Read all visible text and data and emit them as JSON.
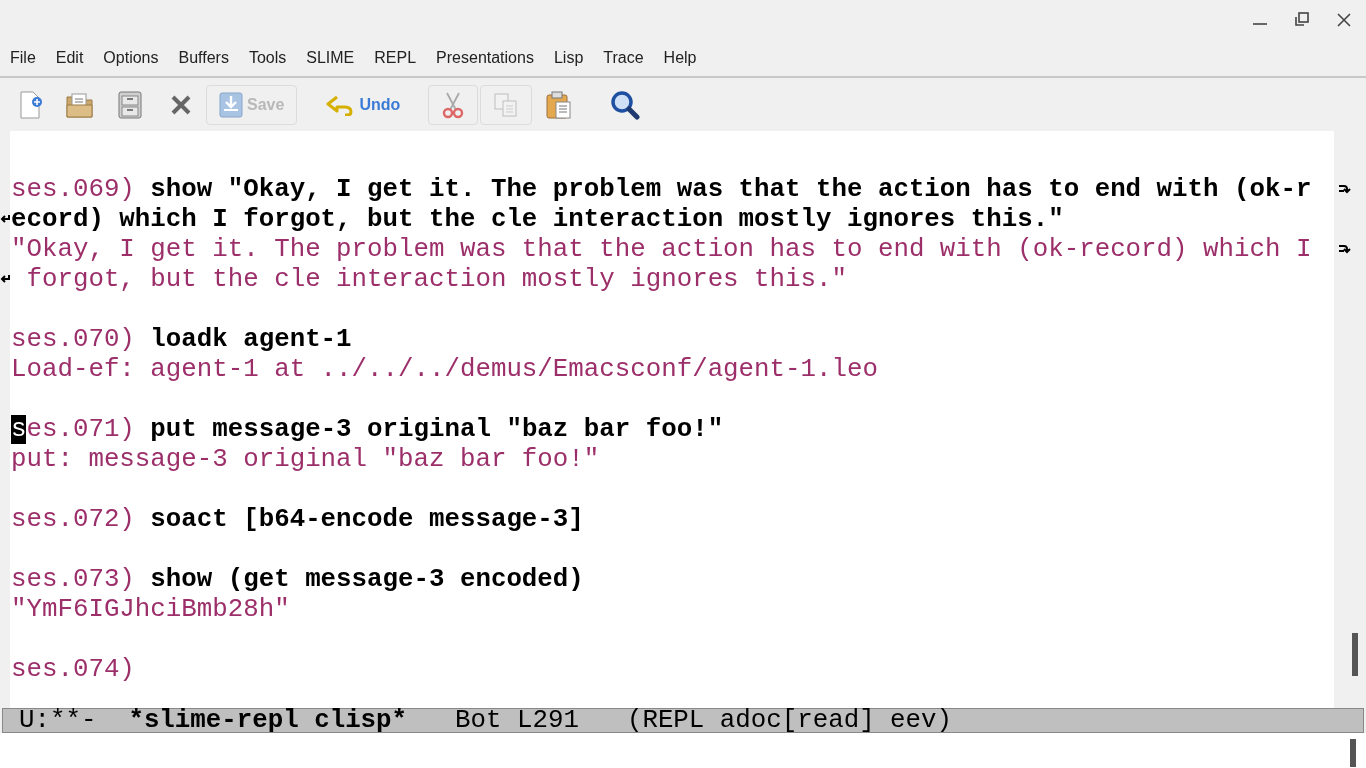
{
  "window": {
    "controls": [
      {
        "kind": "minimize"
      },
      {
        "kind": "restore"
      },
      {
        "kind": "close"
      }
    ]
  },
  "menu_bar": [
    "File",
    "Edit",
    "Options",
    "Buffers",
    "Tools",
    "SLIME",
    "REPL",
    "Presentations",
    "Lisp",
    "Trace",
    "Help"
  ],
  "toolbar": [
    {
      "kind": "new",
      "disabled": false
    },
    {
      "kind": "open",
      "disabled": false
    },
    {
      "kind": "cabinet",
      "disabled": false
    },
    {
      "kind": "close",
      "disabled": false
    },
    {
      "kind": "save",
      "label": "Save",
      "disabled": true
    },
    {
      "kind": "undo",
      "label": "Undo",
      "disabled": false
    },
    {
      "kind": "cut",
      "disabled": true
    },
    {
      "kind": "copy",
      "disabled": true
    },
    {
      "kind": "paste",
      "disabled": false
    },
    {
      "kind": "search",
      "disabled": false
    }
  ],
  "buffer": {
    "lines": [
      {
        "kind": "text",
        "continued": true,
        "segments": [
          {
            "kind": "prompt",
            "text": "ses.069) "
          },
          {
            "kind": "input",
            "text": "show \"Okay, I get it. The problem was that the action has to end with (ok-r"
          }
        ]
      },
      {
        "kind": "text",
        "continued": false,
        "segments": [
          {
            "kind": "input",
            "text": "ecord) which I forgot, but the cle interaction mostly ignores this.\""
          }
        ]
      },
      {
        "kind": "text",
        "continued": true,
        "segments": [
          {
            "kind": "output",
            "text": "\"Okay, I get it. The problem was that the action has to end with (ok-record) which I"
          }
        ]
      },
      {
        "kind": "text",
        "continued": false,
        "segments": [
          {
            "kind": "output",
            "text": " forgot, but the cle interaction mostly ignores this.\""
          }
        ]
      },
      {
        "kind": "blank"
      },
      {
        "kind": "text",
        "continued": false,
        "segments": [
          {
            "kind": "prompt",
            "text": "ses.070) "
          },
          {
            "kind": "input",
            "text": "loadk agent-1"
          }
        ]
      },
      {
        "kind": "text",
        "continued": false,
        "segments": [
          {
            "kind": "output",
            "text": "Load-ef: agent-1 at ../../../demus/Emacsconf/agent-1.leo"
          }
        ]
      },
      {
        "kind": "blank"
      },
      {
        "kind": "text",
        "continued": false,
        "segments": [
          {
            "kind": "prompt",
            "text": "s",
            "cursor": true
          },
          {
            "kind": "prompt",
            "text": "es.071) "
          },
          {
            "kind": "input",
            "text": "put message-3 original \"baz bar foo!\""
          }
        ]
      },
      {
        "kind": "text",
        "continued": false,
        "segments": [
          {
            "kind": "output",
            "text": "put: message-3 original \"baz bar foo!\""
          }
        ]
      },
      {
        "kind": "blank"
      },
      {
        "kind": "text",
        "continued": false,
        "segments": [
          {
            "kind": "prompt",
            "text": "ses.072) "
          },
          {
            "kind": "input",
            "text": "soact [b64-encode message-3]"
          }
        ]
      },
      {
        "kind": "blank"
      },
      {
        "kind": "text",
        "continued": false,
        "segments": [
          {
            "kind": "prompt",
            "text": "ses.073) "
          },
          {
            "kind": "input",
            "text": "show (get message-3 encoded)"
          }
        ]
      },
      {
        "kind": "text",
        "continued": false,
        "segments": [
          {
            "kind": "output",
            "text": "\"YmF6IGJhciBmb28h\""
          }
        ]
      },
      {
        "kind": "blank"
      },
      {
        "kind": "text",
        "continued": false,
        "segments": [
          {
            "kind": "prompt",
            "text": "ses.074)"
          }
        ]
      }
    ]
  },
  "mode_line": {
    "status": "U:**-",
    "buffer_name": "*slime-repl clisp*",
    "position": "Bot L291",
    "modes": "(REPL adoc[read] eev)"
  }
}
